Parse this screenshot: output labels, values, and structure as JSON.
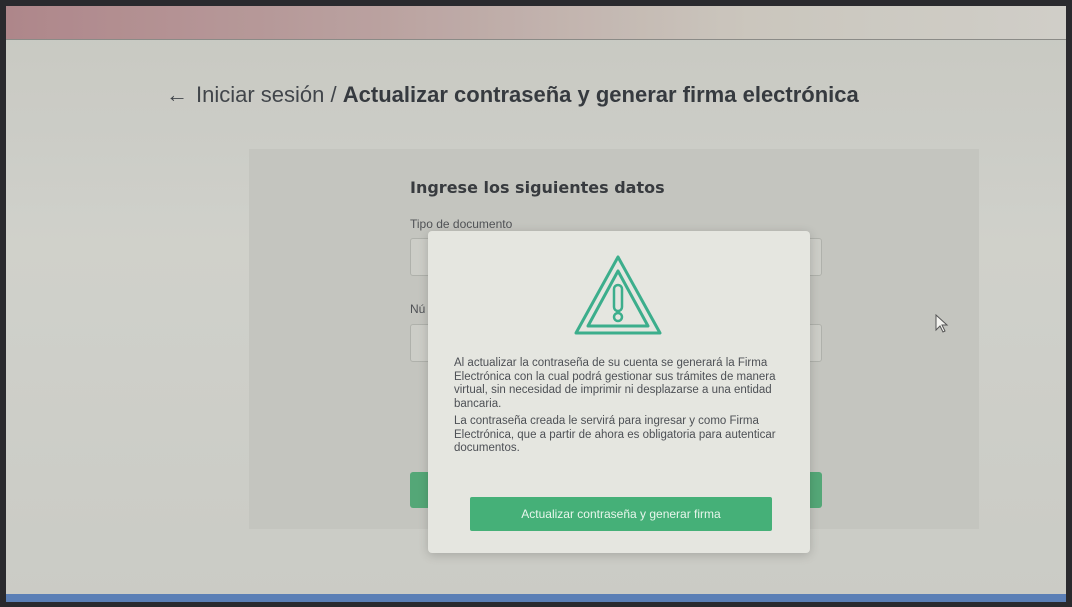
{
  "header": {
    "back_arrow": "←",
    "breadcrumb_parent": "Iniciar sesión",
    "separator": "/",
    "breadcrumb_current": "Actualizar contraseña y generar firma electrónica"
  },
  "form": {
    "title": "Ingrese los siguientes datos",
    "document_type_label": "Tipo de documento",
    "second_label_fragment": "Nú"
  },
  "modal": {
    "icon": "warning-triangle-icon",
    "paragraph1": "Al actualizar la contraseña de su cuenta se generará la Firma Electrónica con la cual podrá gestionar sus trámites de manera virtual, sin necesidad de imprimir ni desplazarse a una entidad bancaria.",
    "paragraph2": "La contraseña creada le servirá para ingresar y como Firma Electrónica, que a partir de ahora es obligatoria para autenticar documentos.",
    "button_label": "Actualizar contraseña y generar firma"
  },
  "colors": {
    "accent_green": "#45b078",
    "taskbar_blue": "#5b7fb6"
  }
}
